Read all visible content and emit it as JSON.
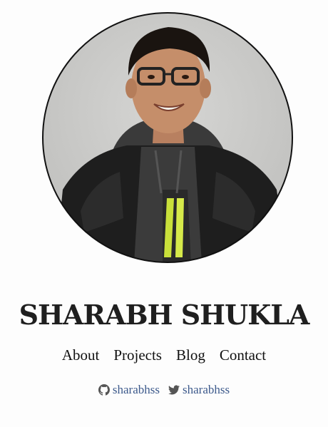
{
  "profile": {
    "name": "SHARABH SHUKLA",
    "photo_icon": "profile-photo"
  },
  "nav": {
    "items": [
      {
        "label": "About"
      },
      {
        "label": "Projects"
      },
      {
        "label": "Blog"
      },
      {
        "label": "Contact"
      }
    ]
  },
  "social": {
    "github": {
      "icon": "github-icon",
      "handle": "sharabhss"
    },
    "twitter": {
      "icon": "twitter-icon",
      "handle": "sharabhss"
    }
  },
  "colors": {
    "background": "#fdfdfd",
    "text": "#1f1f1f",
    "link": "#3d5a8c",
    "icon": "#555555"
  }
}
